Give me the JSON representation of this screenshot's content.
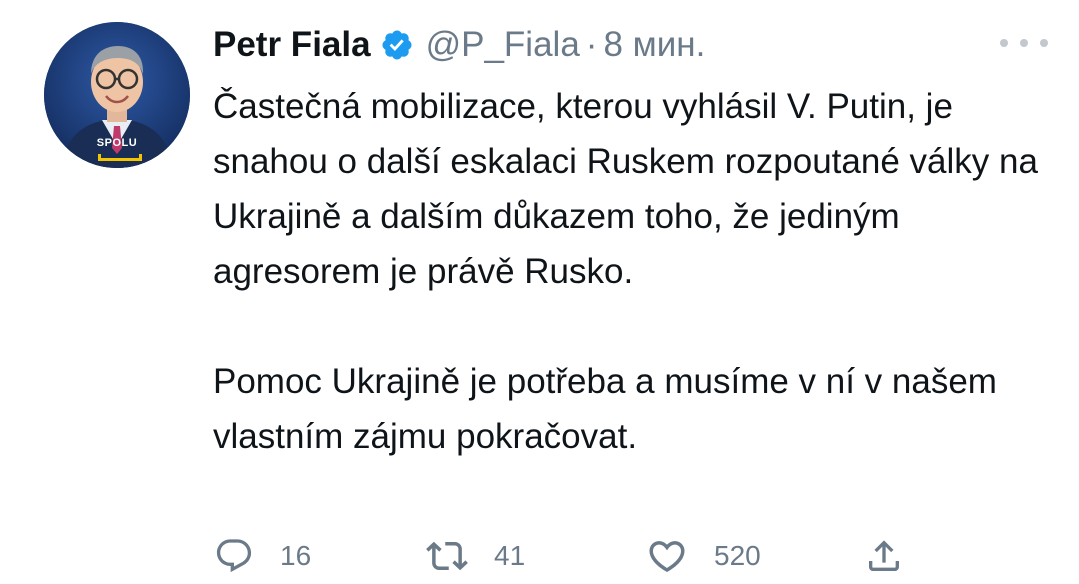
{
  "tweet": {
    "author": {
      "name": "Petr Fiala",
      "handle": "@P_Fiala",
      "separator": "·",
      "time": "8 мин.",
      "avatar_badge": "SPOLU",
      "verified": true
    },
    "text": {
      "paragraph1": "Častečná mobilizace, kterou vyhlásil V. Putin, je snahou o další eskalaci Ruskem rozpoutané války na Ukrajině a dalším důkazem toho, že jediným agresorem je právě Rusko.",
      "paragraph2": "Pomoc Ukrajině je potřeba a musíme v ní v našem vlastním zájmu pokračovat."
    },
    "actions": {
      "replies": "16",
      "retweets": "41",
      "likes": "520"
    },
    "icons": {
      "verified": "verified-badge-icon",
      "more": "more-options-icon",
      "reply": "reply-icon",
      "retweet": "retweet-icon",
      "like": "heart-icon",
      "share": "share-icon"
    },
    "colors": {
      "text": "#0f1419",
      "secondary": "#6b7a89",
      "verified": "#1d9bf0",
      "avatar_bg": "#1b3e7a"
    }
  }
}
